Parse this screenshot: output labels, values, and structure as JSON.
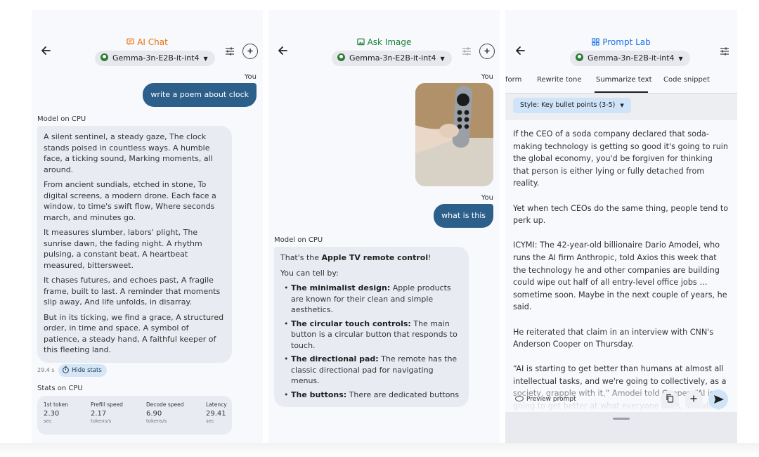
{
  "screens": [
    {
      "title": "AI Chat",
      "title_color": "#e8710a",
      "model": "Gemma-3n-E2B-it-int4",
      "you_label": "You",
      "user_message": "write a poem about clock",
      "model_label": "Model on CPU",
      "response_paragraphs": [
        "A silent sentinel, a steady gaze, The clock stands poised in countless ways. A humble face, a ticking sound, Marking moments, all around.",
        "From ancient sundials, etched in stone, To digital screens, a modern drone. Each face a window, to time's swift flow, Where seconds march, and minutes go.",
        "It measures slumber, labors' plight, The sunrise dawn, the fading night. A rhythm pulsing, a constant beat, A heartbeat measured, bittersweet.",
        "It chases futures, and echoes past, A fragile frame, built to last. A reminder that moments slip away, And life unfolds, in disarray.",
        "But in its ticking, we find a grace, A structured order, in time and space. A symbol of patience, a steady hand, A faithful keeper of this fleeting land."
      ],
      "elapsed": "29.4 s",
      "hide_stats_label": "Hide stats",
      "stats_title": "Stats on CPU",
      "stats": [
        {
          "label": "1st token",
          "value": "2.30",
          "unit": "sec"
        },
        {
          "label": "Prefill speed",
          "value": "2.17",
          "unit": "tokens/s"
        },
        {
          "label": "Decode speed",
          "value": "6.90",
          "unit": "tokens/s"
        },
        {
          "label": "Latency",
          "value": "29.41",
          "unit": "sec"
        }
      ]
    },
    {
      "title": "Ask Image",
      "title_color": "#188038",
      "model": "Gemma-3n-E2B-it-int4",
      "you_label_1": "You",
      "you_label_2": "You",
      "user_message": "what is this",
      "model_label": "Model on CPU",
      "intro_prefix": "That's the ",
      "intro_bold": "Apple TV remote control",
      "intro_suffix": "!",
      "lead": "You can tell by:",
      "bullets": [
        {
          "bold": "The minimalist design:",
          "text": " Apple products are known for their clean and simple aesthetics."
        },
        {
          "bold": "The circular touch controls:",
          "text": " The main button is a circular button that responds to touch."
        },
        {
          "bold": "The directional pad:",
          "text": " The remote has the classic directional pad for navigating menus."
        },
        {
          "bold": "The buttons:",
          "text": " There are dedicated buttons"
        }
      ]
    },
    {
      "title": "Prompt Lab",
      "title_color": "#1a73e8",
      "model": "Gemma-3n-E2B-it-int4",
      "tabs": [
        "form",
        "Rewrite tone",
        "Summarize text",
        "Code snippet"
      ],
      "active_tab": "Summarize text",
      "style_label": "Style: Key bullet points (3-5)",
      "paragraphs": [
        "If the CEO of a soda company declared that soda-making technology is getting so good it's going to ruin the global economy, you'd be forgiven for thinking that person is either lying or fully detached from reality.",
        "Yet when tech CEOs do the same thing, people tend to perk up.",
        "ICYMI: The 42-year-old billionaire Dario Amodei, who runs the AI firm Anthropic, told Axios this week that the technology he and other companies are building could wipe out half of all entry-level office jobs … sometime soon. Maybe in the next couple of years, he said.",
        "He reiterated that claim in an interview with CNN's Anderson Cooper on Thursday.",
        "“AI is starting to get better than humans at almost all intellectual tasks, and we're going to collectively, as a society, grapple with it,” Amodei told Cooper. “AI is going to get better at what everyone does, including"
      ],
      "preview_label": "Preview prompt"
    }
  ]
}
